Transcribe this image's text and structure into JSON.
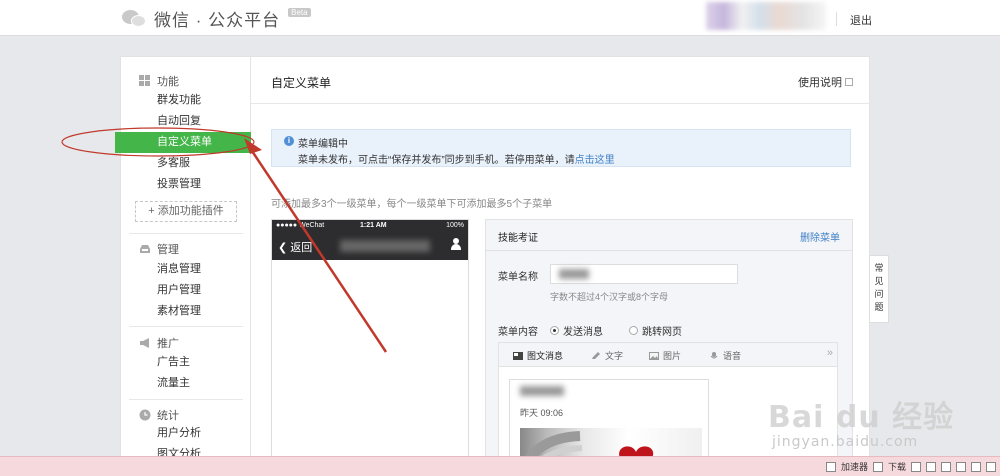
{
  "header": {
    "logo_text": "微信 · 公众平台",
    "beta_badge": "Beta",
    "logout": "退出"
  },
  "sidebar": {
    "groups": [
      {
        "title": "功能",
        "icon": "grid-icon"
      },
      {
        "title": "管理",
        "icon": "inbox-icon"
      },
      {
        "title": "推广",
        "icon": "megaphone-icon"
      },
      {
        "title": "统计",
        "icon": "clock-icon"
      }
    ],
    "items": {
      "mass_send": "群发功能",
      "auto_reply": "自动回复",
      "custom_menu": "自定义菜单",
      "multi_service": "多客服",
      "vote": "投票管理",
      "add_plugin": "+ 添加功能插件",
      "message_mgmt": "消息管理",
      "user_mgmt": "用户管理",
      "material_mgmt": "素材管理",
      "advertiser": "广告主",
      "traffic_owner": "流量主",
      "user_analysis": "用户分析",
      "article_analysis": "图文分析"
    }
  },
  "main": {
    "title": "自定义菜单",
    "help": "使用说明",
    "notice": {
      "title": "菜单编辑中",
      "text": "菜单未发布，可点击“保存并发布”同步到手机。若停用菜单，请",
      "link": "点击这里"
    },
    "hint": "可添加最多3个一级菜单，每个一级菜单下可添加最多5个子菜单"
  },
  "phone": {
    "carrier": "●●●●● WeChat",
    "time": "1:21 AM",
    "battery": "100%",
    "back": "返回"
  },
  "editor": {
    "menu_title": "技能考证",
    "delete": "删除菜单",
    "name_label": "菜单名称",
    "name_tip": "字数不超过4个汉字或8个字母",
    "content_label": "菜单内容",
    "radio_send": "发送消息",
    "radio_link": "跳转网页",
    "tabs": [
      "图文消息",
      "文字",
      "图片",
      "语音"
    ],
    "card_date": "昨天 09:06"
  },
  "faq": [
    "常",
    "见",
    "问",
    "题"
  ],
  "taskbar": {
    "accelerator": "加速器",
    "download": "下载"
  },
  "watermark": {
    "main": "Bai du 经验",
    "sub": "jingyan.baidu.com"
  },
  "colors": {
    "accent_green": "#44b549",
    "link_blue": "#3e7fc4",
    "annotation_red": "#c0392b"
  }
}
